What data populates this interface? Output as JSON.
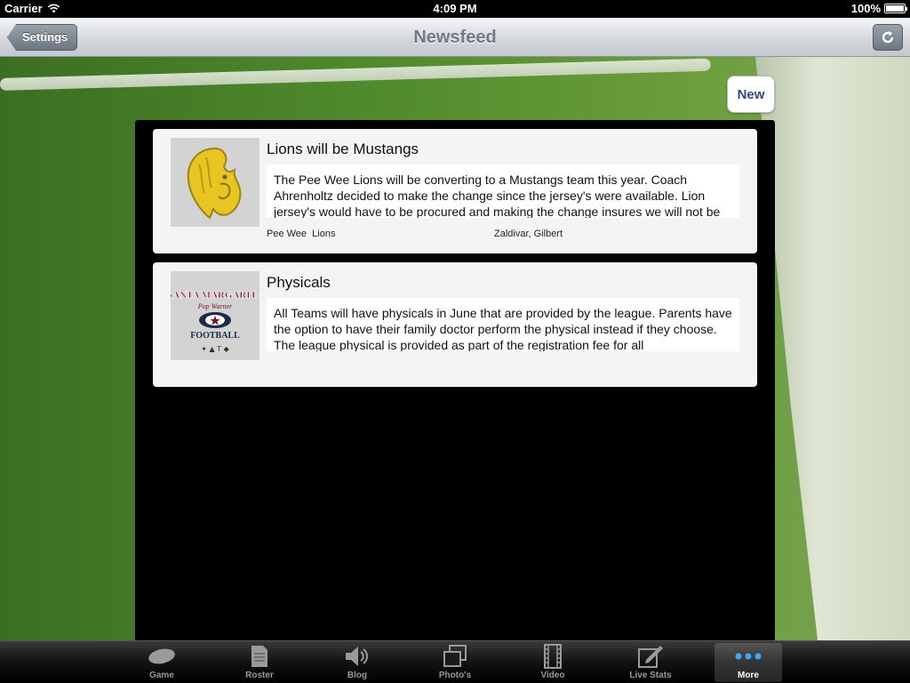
{
  "status_bar": {
    "carrier": "Carrier",
    "time": "4:09 PM",
    "battery": "100%"
  },
  "nav_bar": {
    "title": "Newsfeed",
    "back_label": "Settings"
  },
  "new_button_label": "New",
  "news": [
    {
      "headline": "Lions will be Mustangs",
      "body": "The Pee Wee Lions will be converting to a Mustangs team this year. Coach Ahrenholtz decided to make the change since the jersey's were available. Lion jersey's would have to be procured and making the change insures we will not be",
      "team": "Pee Wee  Lions",
      "author": "Zaldivar, Gilbert"
    },
    {
      "headline": "Physicals",
      "body": "All Teams will have physicals in June that are provided by the league. Parents have the option to have their family doctor perform the physical instead if they choose. The league physical is provided as part of the registration fee for all",
      "team": "",
      "author": "",
      "logo_text": [
        "SANTA MARGARITA",
        "Pop Warner",
        "FOOTBALL"
      ]
    }
  ],
  "tabs": [
    {
      "label": "Game",
      "icon": "football-icon"
    },
    {
      "label": "Roster",
      "icon": "document-icon"
    },
    {
      "label": "Blog",
      "icon": "speaker-icon"
    },
    {
      "label": "Photo's",
      "icon": "photos-icon"
    },
    {
      "label": "Video",
      "icon": "film-icon"
    },
    {
      "label": "Live Stats",
      "icon": "edit-icon"
    },
    {
      "label": "More",
      "icon": "more-icon",
      "selected": true
    }
  ],
  "colors": {
    "accent_blue": "#2c4a7c",
    "selected_dots": "#3ea9f5"
  }
}
